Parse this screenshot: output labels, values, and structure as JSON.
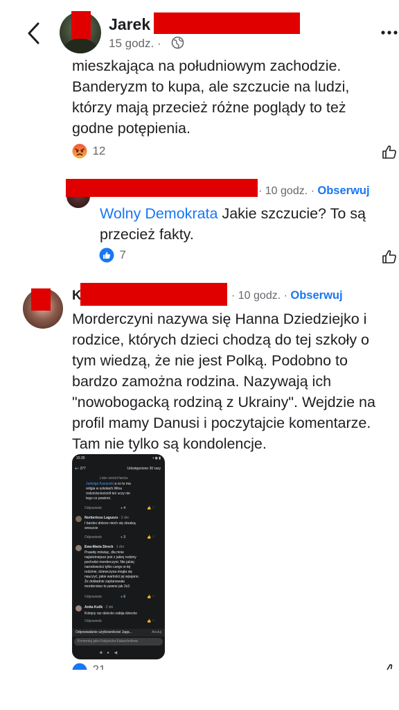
{
  "header": {
    "back_icon": "chevron-left-icon",
    "author_name": "Jarek",
    "time": "15 godz. ·",
    "privacy_icon": "globe-icon",
    "more_icon": "more-dots-icon"
  },
  "comment1": {
    "lines": [
      "mieszkająca na południowym zachodzie.",
      "Banderyzm to kupa, ale szczucie na ludzi,",
      "którzy mają przecież różne poglądy to też",
      "godne potępienia."
    ],
    "reaction_icon": "angry-emoji-icon",
    "reaction_count": "12"
  },
  "reply1": {
    "time": "· 10 godz. ·",
    "follow": "Obserwuj",
    "mention": "Wolny Demokrata",
    "text_line1": " Jakie szczucie? To są",
    "text_line2": "przecież fakty.",
    "reaction_icon": "like-reaction-icon",
    "reaction_count": "7"
  },
  "comment2": {
    "initial": "K",
    "time": "· 10 godz. ·",
    "follow": "Obserwuj",
    "lines": [
      "Morderczyni nazywa się Hanna Dziedziejko i",
      "rodzice, których dzieci chodzą do tej szkoły o",
      "tym wiedzą, że nie jest Polką. Podobno to",
      "bardzo zamożna rodzina. Nazywają ich",
      "\"nowobogacką rodziną z Ukrainy\". Wejdzie na",
      "profil mamy Danusi i poczytajcie komentarze.",
      "Tam nie tylko są kondolencje."
    ],
    "reaction_count_partial": "21"
  },
  "embedded_screenshot": {
    "status_time": "15:35",
    "reactions": "377",
    "shared": "Udostępniono 30 razy",
    "top_badge": "Lider wśród fanów",
    "c1_mention": "Jadwiga Kasanski",
    "c1_text": [
      "a co tu ma",
      "religia w szkołach.Wina",
      "rodziców.kościół też uczy nie",
      "tego co powinni."
    ],
    "c1_action": "Odpowiedz",
    "c1_count": "4",
    "c2_name": "Norbertoss Laguszo",
    "c2_time": "· 2 dni",
    "c2_text": [
      "I bardzo dobrze niech się obudzą",
      "wreszcie"
    ],
    "c2_action": "Odpowiedz",
    "c2_count": "3",
    "c3_name": "Ewa-Maria Streck",
    "c3_time": "· 1 dni",
    "c3_text": [
      "Prawdę mówiąc, dla mnie",
      "najistotniejsze jest z jakiej rodziny",
      "pochodzi morderczyni. Nie jakiej",
      "narodowości tylko czego w tej",
      "rodzinie, dziewczyna mogła się",
      "nauczyć, jakie wartości jej wpajano.",
      "Że dokładnie zaplanowała",
      "morderstwo to pewne jak 2x2."
    ],
    "c3_action": "Odpowiedz",
    "c3_count": "6",
    "c4_name": "Anita Kulik",
    "c4_time": "· 2 dni",
    "c4_text": "Kolejny raz dziecko zabija dziecko",
    "c4_action": "Odpowiedz",
    "reply_bar": "Odpowiadanie użytkownikowi Jaga...",
    "reply_cancel": "Anuluj",
    "comment_as": "Komentuj jako Katjuscha Kalaschnikow"
  },
  "colors": {
    "link_blue": "#1877f2",
    "redaction": "#e00000",
    "meta_grey": "#65676b"
  }
}
